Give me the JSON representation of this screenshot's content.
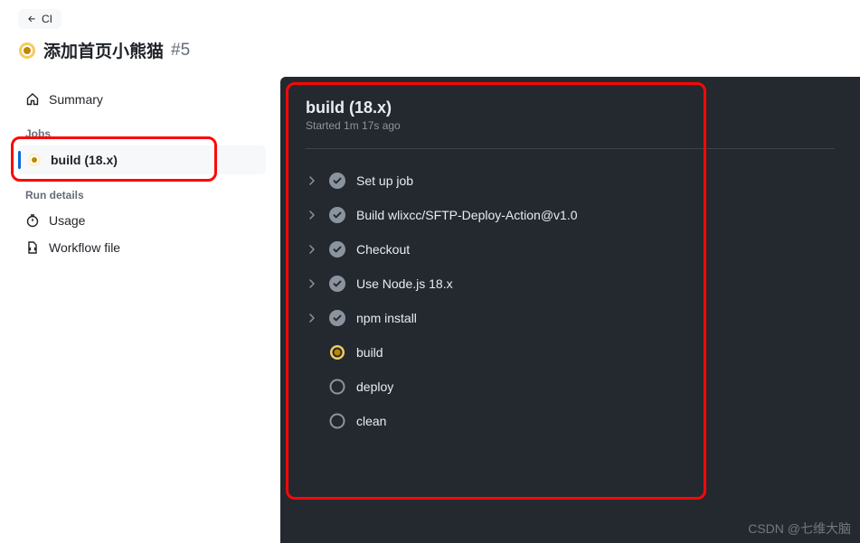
{
  "breadcrumb": {
    "label": "CI"
  },
  "title": {
    "text": "添加首页小熊猫",
    "number": "#5"
  },
  "sidebar": {
    "summary": "Summary",
    "jobs_heading": "Jobs",
    "job": "build (18.x)",
    "run_details_heading": "Run details",
    "usage": "Usage",
    "workflow_file": "Workflow file"
  },
  "detail": {
    "title": "build (18.x)",
    "subtitle": "Started 1m 17s ago",
    "steps": [
      {
        "label": "Set up job",
        "status": "success",
        "expandable": true
      },
      {
        "label": "Build wlixcc/SFTP-Deploy-Action@v1.0",
        "status": "success",
        "expandable": true
      },
      {
        "label": "Checkout",
        "status": "success",
        "expandable": true
      },
      {
        "label": "Use Node.js 18.x",
        "status": "success",
        "expandable": true
      },
      {
        "label": "npm install",
        "status": "success",
        "expandable": true
      },
      {
        "label": "build",
        "status": "running",
        "expandable": false
      },
      {
        "label": "deploy",
        "status": "pending",
        "expandable": false
      },
      {
        "label": "clean",
        "status": "pending",
        "expandable": false
      }
    ]
  },
  "watermark": "CSDN @七维大脑"
}
